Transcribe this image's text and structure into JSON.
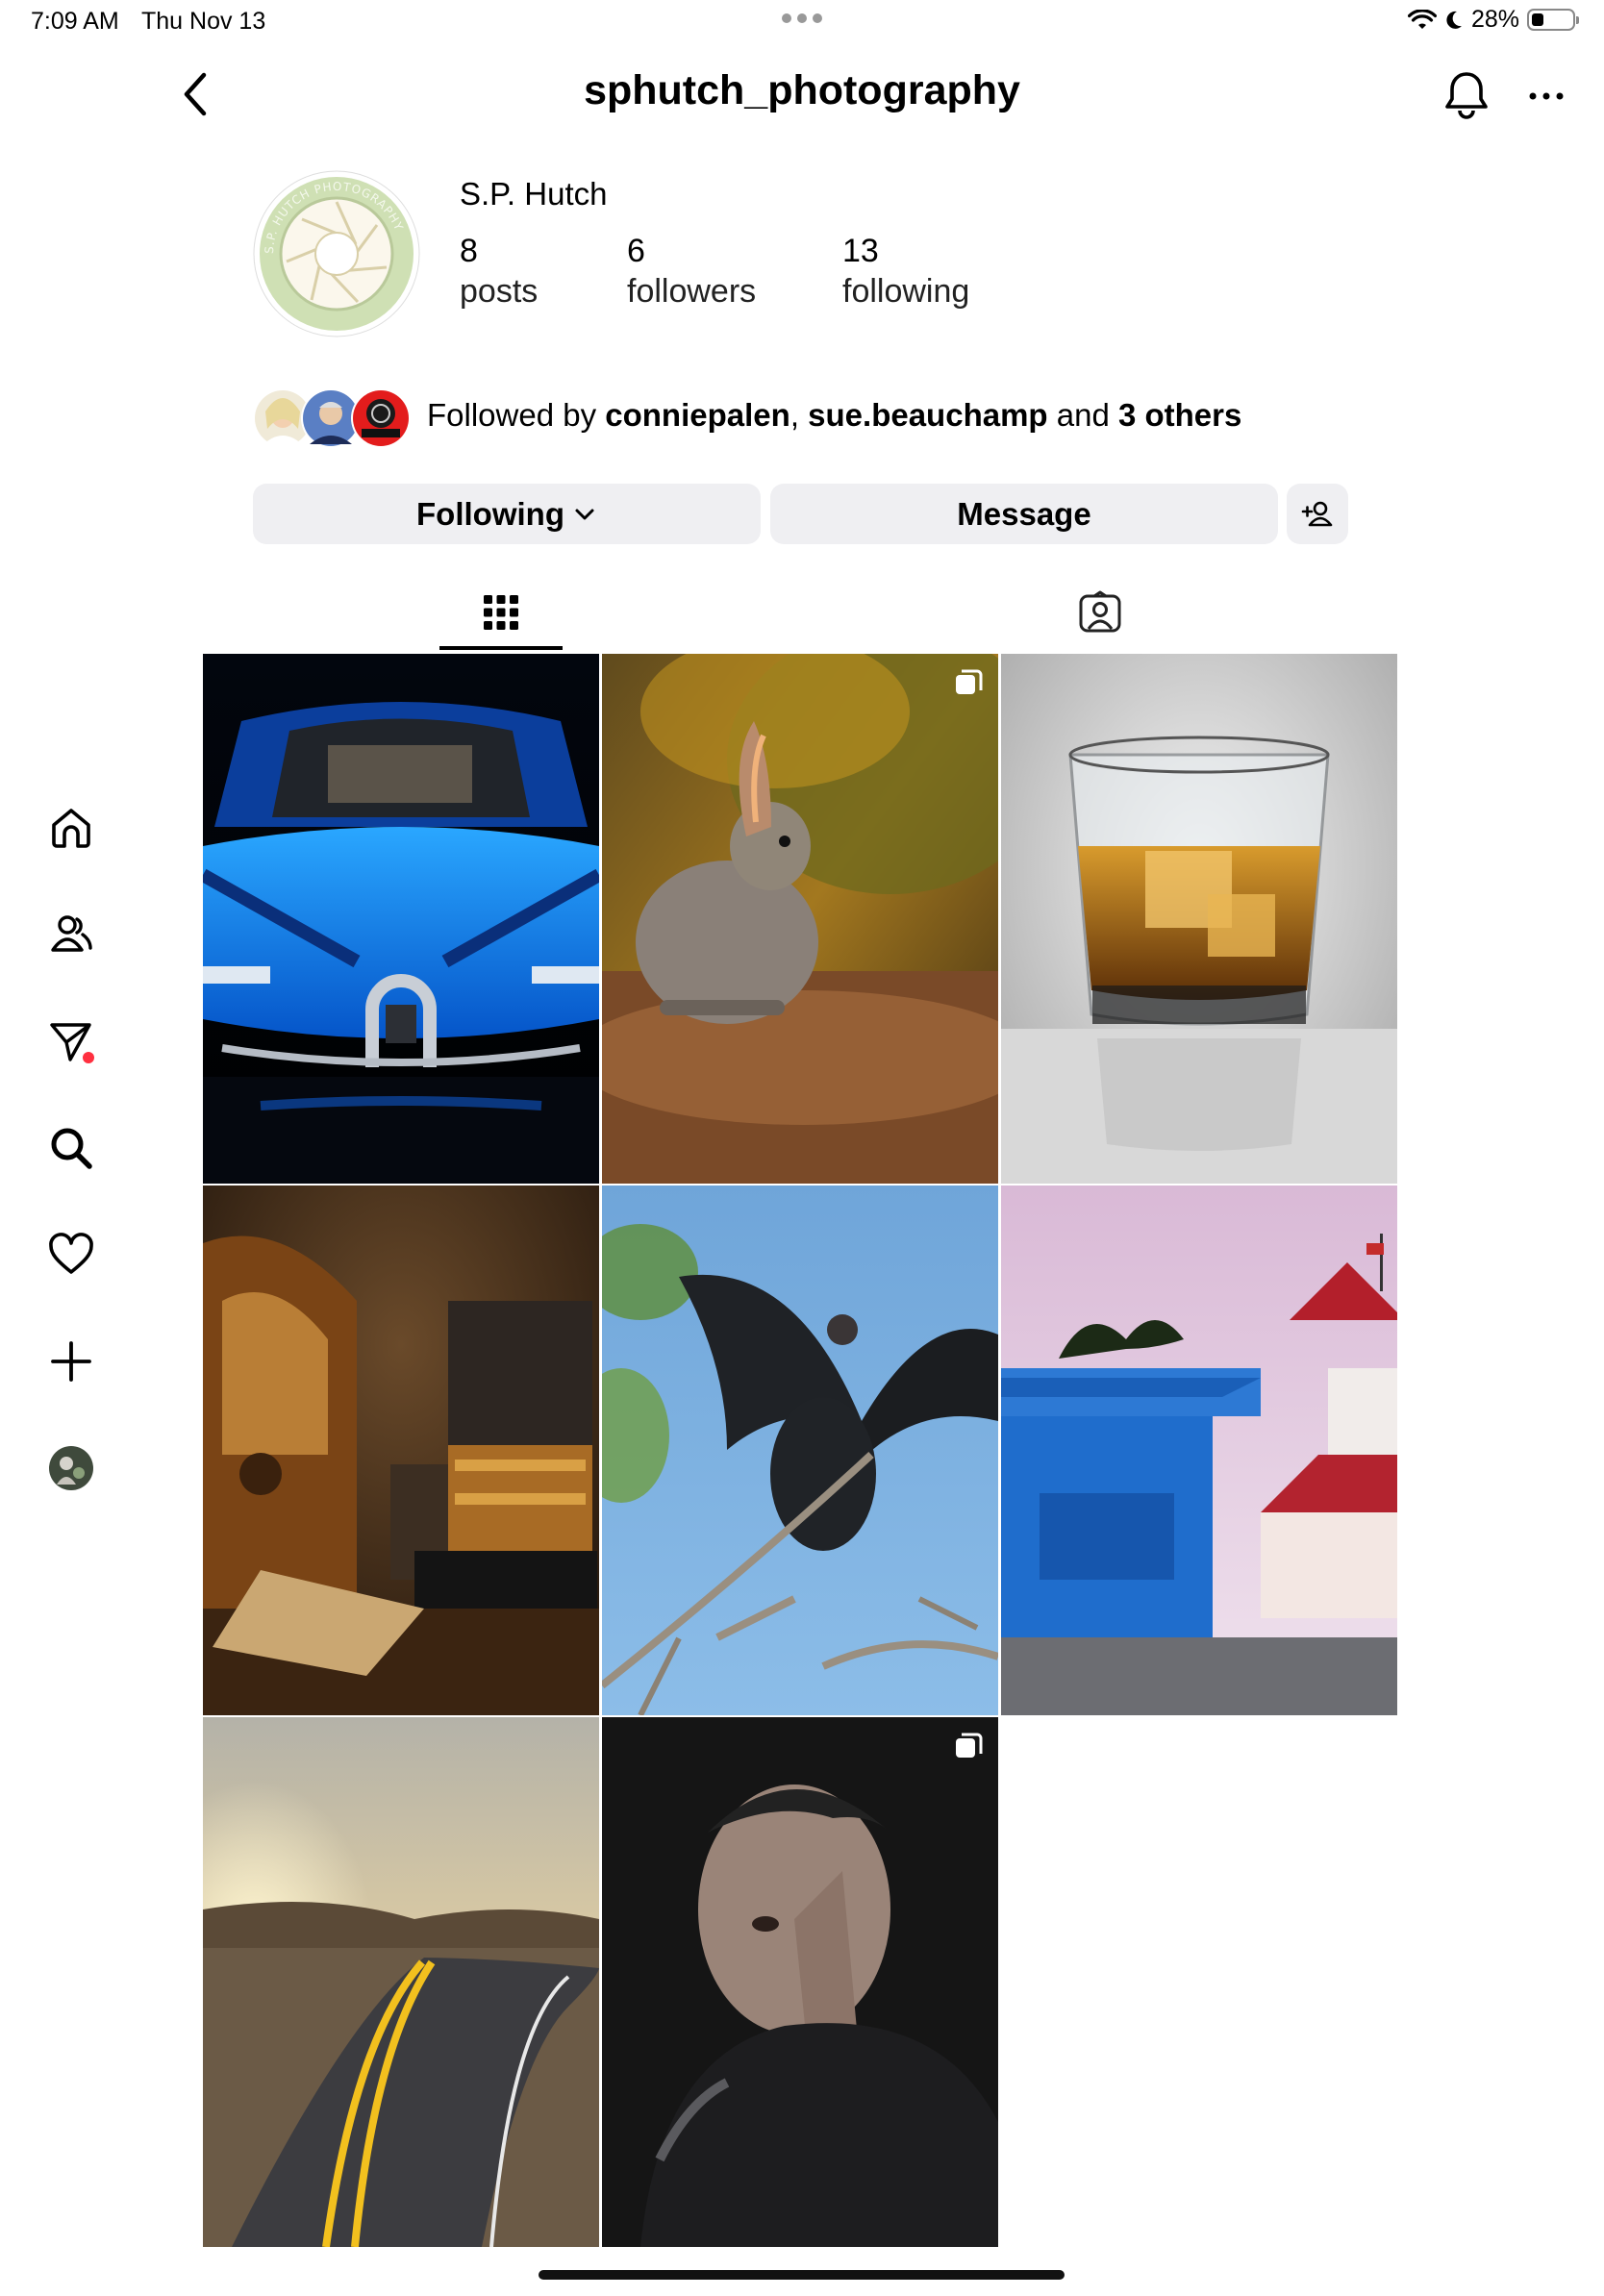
{
  "status_bar": {
    "time": "7:09 AM",
    "date": "Thu Nov 13",
    "battery": "28%"
  },
  "header": {
    "username": "sphutch_photography"
  },
  "profile": {
    "display_name": "S.P. Hutch",
    "stats": [
      {
        "value": "8",
        "label": "posts"
      },
      {
        "value": "6",
        "label": "followers"
      },
      {
        "value": "13",
        "label": "following"
      }
    ],
    "avatar_ring_text": "S.P. HUTCH PHOTOGRAPHY",
    "followed_by": {
      "prefix": "Followed by",
      "user1": "conniepalen",
      "sep": ",",
      "user2": "sue.beauchamp",
      "and": "and",
      "others": "3 others"
    }
  },
  "actions": {
    "following_label": "Following",
    "message_label": "Message"
  },
  "tabs": [
    {
      "name": "posts-grid",
      "icon": "grid-icon",
      "active": true
    },
    {
      "name": "tagged",
      "icon": "tagged-person-icon",
      "active": false
    }
  ],
  "sidebar": [
    {
      "name": "home",
      "icon": "home-icon"
    },
    {
      "name": "people",
      "icon": "people-icon"
    },
    {
      "name": "messages",
      "icon": "direct-icon",
      "badge": true
    },
    {
      "name": "search",
      "icon": "search-icon"
    },
    {
      "name": "activity",
      "icon": "heart-icon"
    },
    {
      "name": "create",
      "icon": "plus-icon"
    },
    {
      "name": "profile",
      "icon": "profile-avatar"
    }
  ],
  "posts": [
    {
      "subject": "blue sports car front",
      "multi": false
    },
    {
      "subject": "rabbit at sunset",
      "multi": true
    },
    {
      "subject": "whiskey glass with ice",
      "multi": false
    },
    {
      "subject": "vintage radio and camera still life",
      "multi": false
    },
    {
      "subject": "vulture with spread wings",
      "multi": false
    },
    {
      "subject": "lifeguard tower and hotel",
      "multi": false
    },
    {
      "subject": "desert road at sunrise",
      "multi": false
    },
    {
      "subject": "portrait of tattooed man",
      "multi": true
    }
  ],
  "colors": {
    "button_bg": "#efeff2",
    "notification_dot": "#ff3040"
  }
}
